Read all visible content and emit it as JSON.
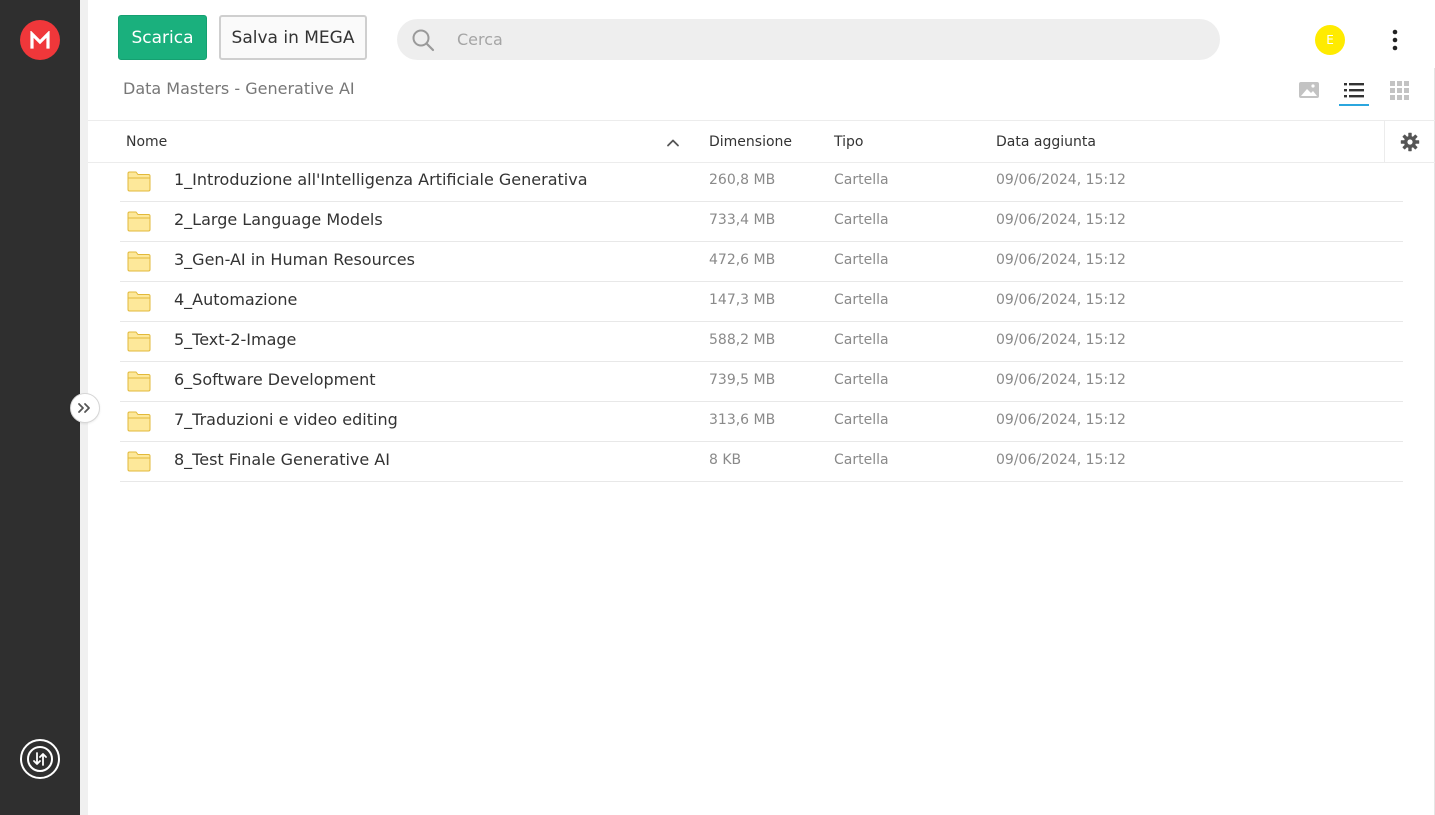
{
  "app": {
    "logo_icon": "mega-logo-icon",
    "accent_color": "#1ab07d",
    "brand_color": "#f0373a"
  },
  "toolbar": {
    "download_label": "Scarica",
    "save_label": "Salva in MEGA"
  },
  "search": {
    "placeholder": "Cerca",
    "value": ""
  },
  "user": {
    "avatar_initial": "E",
    "avatar_color": "#ffeb00"
  },
  "breadcrumb": {
    "path": "Data Masters - Generative AI"
  },
  "view_modes": {
    "active": "list",
    "options": [
      "thumbnail",
      "list",
      "grid"
    ]
  },
  "table": {
    "columns": {
      "name": "Nome",
      "size": "Dimensione",
      "type": "Tipo",
      "date": "Data aggiunta"
    },
    "sort": {
      "column": "name",
      "direction": "ascending"
    },
    "rows": [
      {
        "name": "1_Introduzione all'Intelligenza Artificiale Generativa",
        "size": "260,8 MB",
        "type": "Cartella",
        "date": "09/06/2024, 15:12"
      },
      {
        "name": "2_Large Language Models",
        "size": "733,4 MB",
        "type": "Cartella",
        "date": "09/06/2024, 15:12"
      },
      {
        "name": "3_Gen-AI in Human Resources",
        "size": "472,6 MB",
        "type": "Cartella",
        "date": "09/06/2024, 15:12"
      },
      {
        "name": "4_Automazione",
        "size": "147,3 MB",
        "type": "Cartella",
        "date": "09/06/2024, 15:12"
      },
      {
        "name": "5_Text-2-Image",
        "size": "588,2 MB",
        "type": "Cartella",
        "date": "09/06/2024, 15:12"
      },
      {
        "name": "6_Software Development",
        "size": "739,5 MB",
        "type": "Cartella",
        "date": "09/06/2024, 15:12"
      },
      {
        "name": "7_Traduzioni e video editing",
        "size": "313,6 MB",
        "type": "Cartella",
        "date": "09/06/2024, 15:12"
      },
      {
        "name": "8_Test Finale Generative AI",
        "size": "8 KB",
        "type": "Cartella",
        "date": "09/06/2024, 15:12"
      }
    ]
  }
}
